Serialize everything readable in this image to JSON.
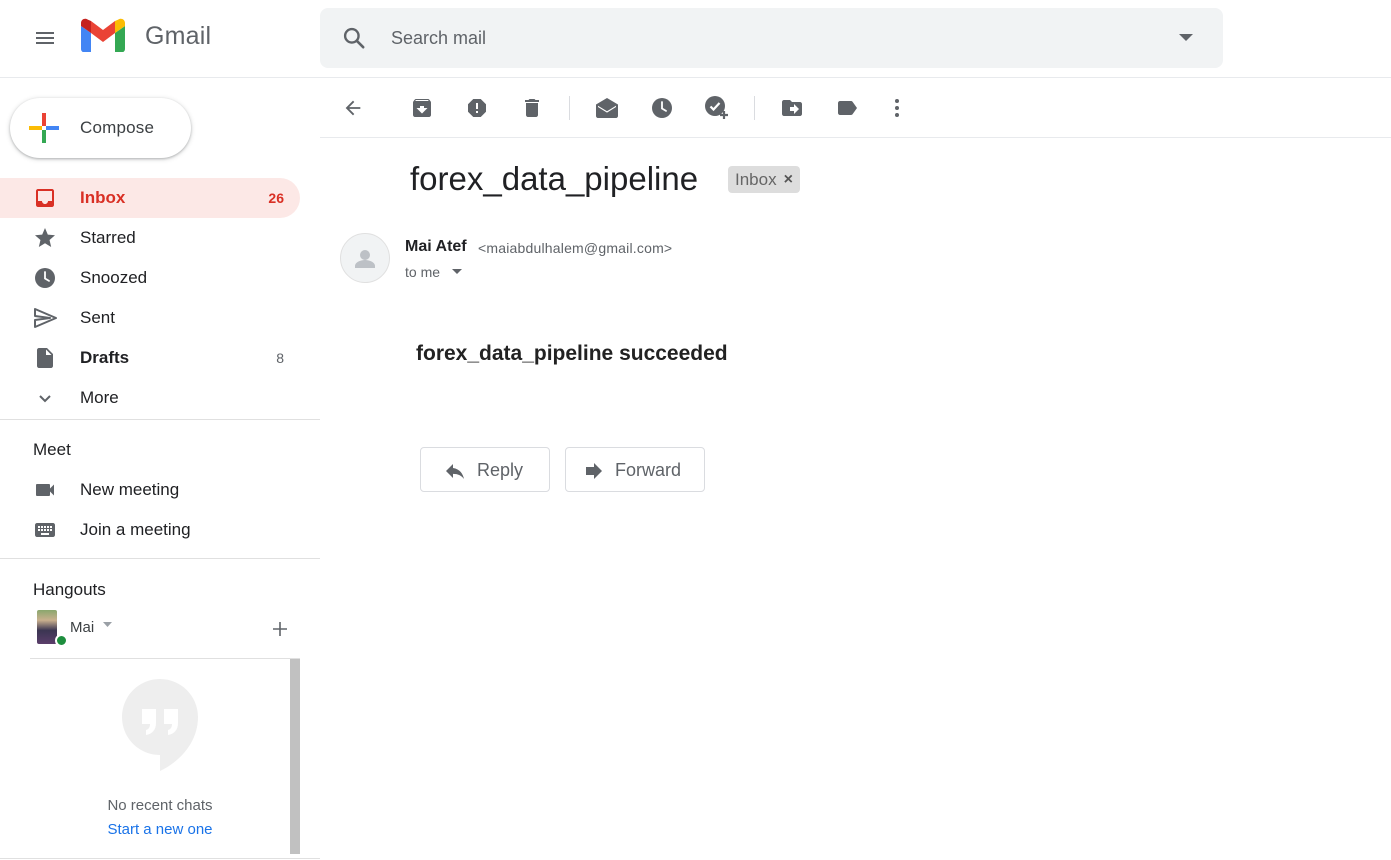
{
  "header": {
    "app_name": "Gmail",
    "search_placeholder": "Search mail"
  },
  "sidebar": {
    "compose_label": "Compose",
    "items": [
      {
        "label": "Inbox",
        "count": "26",
        "icon": "inbox-icon"
      },
      {
        "label": "Starred",
        "count": "",
        "icon": "star-icon"
      },
      {
        "label": "Snoozed",
        "count": "",
        "icon": "clock-icon"
      },
      {
        "label": "Sent",
        "count": "",
        "icon": "send-icon"
      },
      {
        "label": "Drafts",
        "count": "8",
        "icon": "draft-icon"
      },
      {
        "label": "More",
        "count": "",
        "icon": "chevron-down-icon"
      }
    ],
    "meet": {
      "title": "Meet",
      "new_meeting": "New meeting",
      "join_meeting": "Join a meeting"
    },
    "hangouts": {
      "title": "Hangouts",
      "user_name": "Mai",
      "no_recent": "No recent chats",
      "start_new": "Start a new one"
    }
  },
  "toolbar": {
    "buttons": [
      "back-icon",
      "archive-icon",
      "report-spam-icon",
      "delete-icon",
      "mark-unread-icon",
      "snooze-icon",
      "add-task-icon",
      "move-to-icon",
      "label-icon",
      "more-icon"
    ]
  },
  "message": {
    "subject": "forex_data_pipeline",
    "label": "Inbox",
    "label_remove": "×",
    "sender_name": "Mai Atef",
    "sender_email": "<maiabdulhalem@gmail.com>",
    "recipient": "to me",
    "body": "forex_data_pipeline succeeded",
    "reply_label": "Reply",
    "forward_label": "Forward"
  },
  "colors": {
    "accent_red": "#d93025",
    "active_bg": "#fce8e6",
    "link_blue": "#1a73e8",
    "online_green": "#1e8e3e"
  }
}
